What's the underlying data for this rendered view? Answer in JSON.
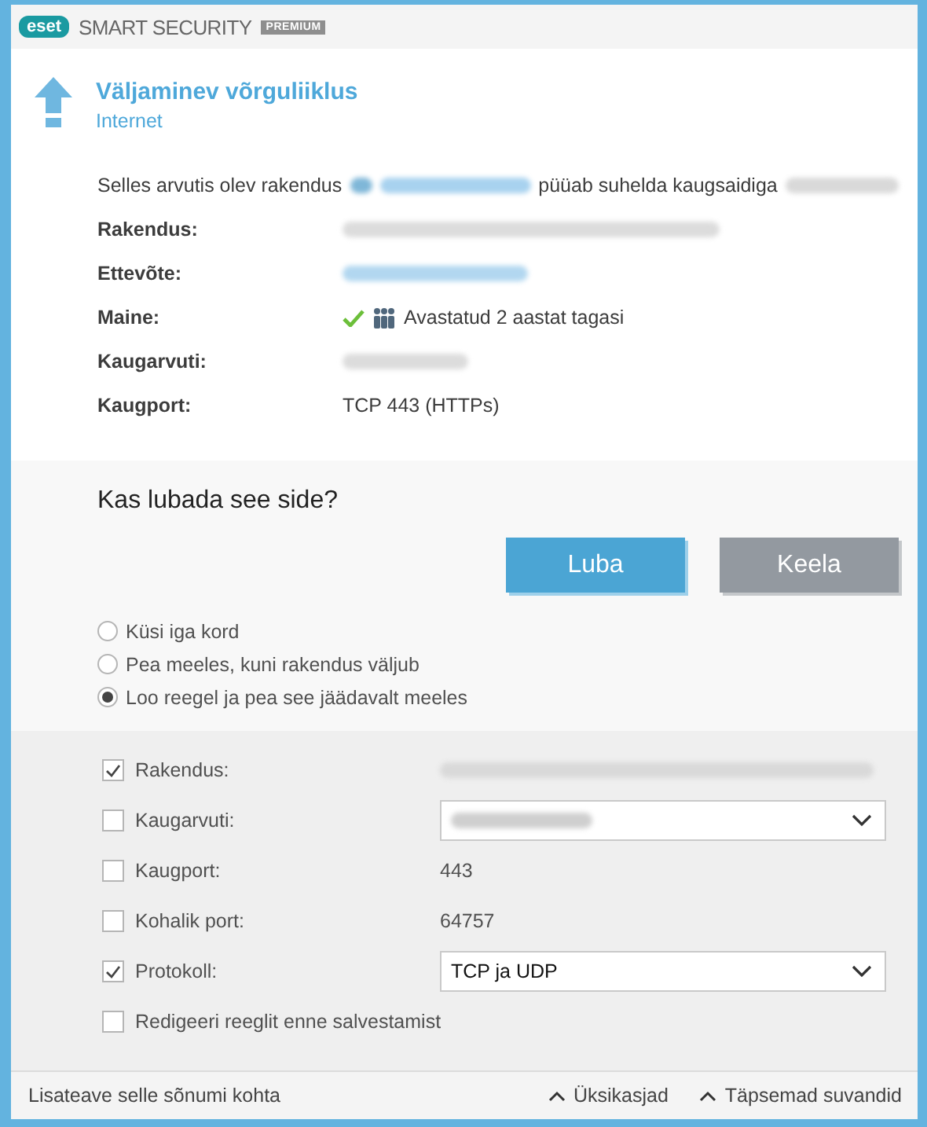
{
  "header": {
    "brand": "eset",
    "product": "SMART SECURITY",
    "edition": "PREMIUM"
  },
  "alert": {
    "title": "Väljaminev võrguliiklus",
    "subtitle": "Internet"
  },
  "message": {
    "before": "Selles arvutis olev rakendus",
    "middle": "püüab suhelda kaugsaidiga"
  },
  "details": [
    {
      "label": "Rakendus:",
      "kind": "blurred"
    },
    {
      "label": "Ettevõte:",
      "kind": "blurred_link"
    },
    {
      "label": "Maine:",
      "kind": "reputation",
      "value": "Avastatud 2 aastat tagasi"
    },
    {
      "label": "Kaugarvuti:",
      "kind": "blurred_short"
    },
    {
      "label": "Kaugport:",
      "kind": "text",
      "value": "TCP 443 (HTTPs)"
    }
  ],
  "question": "Kas lubada see side?",
  "buttons": [
    {
      "label": "Luba",
      "kind": "primary"
    },
    {
      "label": "Keela",
      "kind": "secondary"
    }
  ],
  "remember_options": [
    {
      "label": "Küsi iga kord",
      "selected": false
    },
    {
      "label": "Pea meeles, kuni rakendus väljub",
      "selected": false
    },
    {
      "label": "Loo reegel ja pea see jäädavalt meeles",
      "selected": true
    }
  ],
  "rule_options": [
    {
      "label": "Rakendus:",
      "checked": true,
      "kind": "blurred"
    },
    {
      "label": "Kaugarvuti:",
      "checked": false,
      "kind": "dropdown_blurred"
    },
    {
      "label": "Kaugport:",
      "checked": false,
      "kind": "text",
      "value": "443"
    },
    {
      "label": "Kohalik port:",
      "checked": false,
      "kind": "text",
      "value": "64757"
    },
    {
      "label": "Protokoll:",
      "checked": true,
      "kind": "dropdown",
      "value": "TCP ja UDP"
    },
    {
      "label": "Redigeeri reeglit enne salvestamist",
      "checked": false,
      "kind": "none"
    }
  ],
  "footer": {
    "link": "Lisateave selle sõnumi kohta",
    "toggles": [
      "Üksikasjad",
      "Täpsemad suvandid"
    ]
  }
}
